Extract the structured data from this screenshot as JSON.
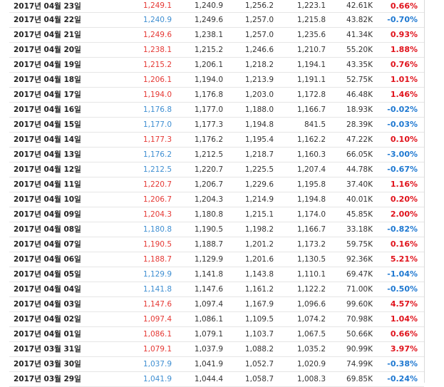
{
  "colors": {
    "up": "#e53935",
    "down": "#3f8fd2",
    "change_up": "#e0121b",
    "change_down": "#1e78d1"
  },
  "rows": [
    {
      "date": "2017년 04월 23일",
      "close": "1,249.1",
      "open": "1,240.9",
      "high": "1,256.2",
      "low": "1,223.1",
      "volume": "42.61K",
      "change": "0.66%",
      "dir": "up"
    },
    {
      "date": "2017년 04월 22일",
      "close": "1,240.9",
      "open": "1,249.6",
      "high": "1,257.0",
      "low": "1,215.8",
      "volume": "43.82K",
      "change": "-0.70%",
      "dir": "down"
    },
    {
      "date": "2017년 04월 21일",
      "close": "1,249.6",
      "open": "1,238.1",
      "high": "1,257.0",
      "low": "1,235.6",
      "volume": "41.34K",
      "change": "0.93%",
      "dir": "up"
    },
    {
      "date": "2017년 04월 20일",
      "close": "1,238.1",
      "open": "1,215.2",
      "high": "1,246.6",
      "low": "1,210.7",
      "volume": "55.20K",
      "change": "1.88%",
      "dir": "up"
    },
    {
      "date": "2017년 04월 19일",
      "close": "1,215.2",
      "open": "1,206.1",
      "high": "1,218.2",
      "low": "1,194.1",
      "volume": "43.35K",
      "change": "0.76%",
      "dir": "up"
    },
    {
      "date": "2017년 04월 18일",
      "close": "1,206.1",
      "open": "1,194.0",
      "high": "1,213.9",
      "low": "1,191.1",
      "volume": "52.75K",
      "change": "1.01%",
      "dir": "up"
    },
    {
      "date": "2017년 04월 17일",
      "close": "1,194.0",
      "open": "1,176.8",
      "high": "1,203.0",
      "low": "1,172.8",
      "volume": "46.48K",
      "change": "1.46%",
      "dir": "up"
    },
    {
      "date": "2017년 04월 16일",
      "close": "1,176.8",
      "open": "1,177.0",
      "high": "1,188.0",
      "low": "1,166.7",
      "volume": "18.93K",
      "change": "-0.02%",
      "dir": "down"
    },
    {
      "date": "2017년 04월 15일",
      "close": "1,177.0",
      "open": "1,177.3",
      "high": "1,194.8",
      "low": "841.5",
      "volume": "28.39K",
      "change": "-0.03%",
      "dir": "down"
    },
    {
      "date": "2017년 04월 14일",
      "close": "1,177.3",
      "open": "1,176.2",
      "high": "1,195.4",
      "low": "1,162.2",
      "volume": "47.22K",
      "change": "0.10%",
      "dir": "up"
    },
    {
      "date": "2017년 04월 13일",
      "close": "1,176.2",
      "open": "1,212.5",
      "high": "1,218.7",
      "low": "1,160.3",
      "volume": "66.05K",
      "change": "-3.00%",
      "dir": "down"
    },
    {
      "date": "2017년 04월 12일",
      "close": "1,212.5",
      "open": "1,220.7",
      "high": "1,225.5",
      "low": "1,207.4",
      "volume": "44.78K",
      "change": "-0.67%",
      "dir": "down"
    },
    {
      "date": "2017년 04월 11일",
      "close": "1,220.7",
      "open": "1,206.7",
      "high": "1,229.6",
      "low": "1,195.8",
      "volume": "37.40K",
      "change": "1.16%",
      "dir": "up"
    },
    {
      "date": "2017년 04월 10일",
      "close": "1,206.7",
      "open": "1,204.3",
      "high": "1,214.9",
      "low": "1,194.8",
      "volume": "40.01K",
      "change": "0.20%",
      "dir": "up"
    },
    {
      "date": "2017년 04월 09일",
      "close": "1,204.3",
      "open": "1,180.8",
      "high": "1,215.1",
      "low": "1,174.0",
      "volume": "45.85K",
      "change": "2.00%",
      "dir": "up"
    },
    {
      "date": "2017년 04월 08일",
      "close": "1,180.8",
      "open": "1,190.5",
      "high": "1,198.2",
      "low": "1,166.7",
      "volume": "33.18K",
      "change": "-0.82%",
      "dir": "down"
    },
    {
      "date": "2017년 04월 07일",
      "close": "1,190.5",
      "open": "1,188.7",
      "high": "1,201.2",
      "low": "1,173.2",
      "volume": "59.75K",
      "change": "0.16%",
      "dir": "up"
    },
    {
      "date": "2017년 04월 06일",
      "close": "1,188.7",
      "open": "1,129.9",
      "high": "1,201.6",
      "low": "1,130.5",
      "volume": "92.36K",
      "change": "5.21%",
      "dir": "up"
    },
    {
      "date": "2017년 04월 05일",
      "close": "1,129.9",
      "open": "1,141.8",
      "high": "1,143.8",
      "low": "1,110.1",
      "volume": "69.47K",
      "change": "-1.04%",
      "dir": "down"
    },
    {
      "date": "2017년 04월 04일",
      "close": "1,141.8",
      "open": "1,147.6",
      "high": "1,161.2",
      "low": "1,122.2",
      "volume": "71.00K",
      "change": "-0.50%",
      "dir": "down"
    },
    {
      "date": "2017년 04월 03일",
      "close": "1,147.6",
      "open": "1,097.4",
      "high": "1,167.9",
      "low": "1,096.6",
      "volume": "99.60K",
      "change": "4.57%",
      "dir": "up"
    },
    {
      "date": "2017년 04월 02일",
      "close": "1,097.4",
      "open": "1,086.1",
      "high": "1,109.5",
      "low": "1,074.2",
      "volume": "70.98K",
      "change": "1.04%",
      "dir": "up"
    },
    {
      "date": "2017년 04월 01일",
      "close": "1,086.1",
      "open": "1,079.1",
      "high": "1,103.7",
      "low": "1,067.5",
      "volume": "50.66K",
      "change": "0.66%",
      "dir": "up"
    },
    {
      "date": "2017년 03월 31일",
      "close": "1,079.1",
      "open": "1,037.9",
      "high": "1,088.2",
      "low": "1,035.2",
      "volume": "90.99K",
      "change": "3.97%",
      "dir": "up"
    },
    {
      "date": "2017년 03월 30일",
      "close": "1,037.9",
      "open": "1,041.9",
      "high": "1,052.7",
      "low": "1,020.9",
      "volume": "74.99K",
      "change": "-0.38%",
      "dir": "down"
    },
    {
      "date": "2017년 03월 29일",
      "close": "1,041.9",
      "open": "1,044.4",
      "high": "1,058.7",
      "low": "1,008.3",
      "volume": "69.85K",
      "change": "-0.24%",
      "dir": "down"
    }
  ]
}
